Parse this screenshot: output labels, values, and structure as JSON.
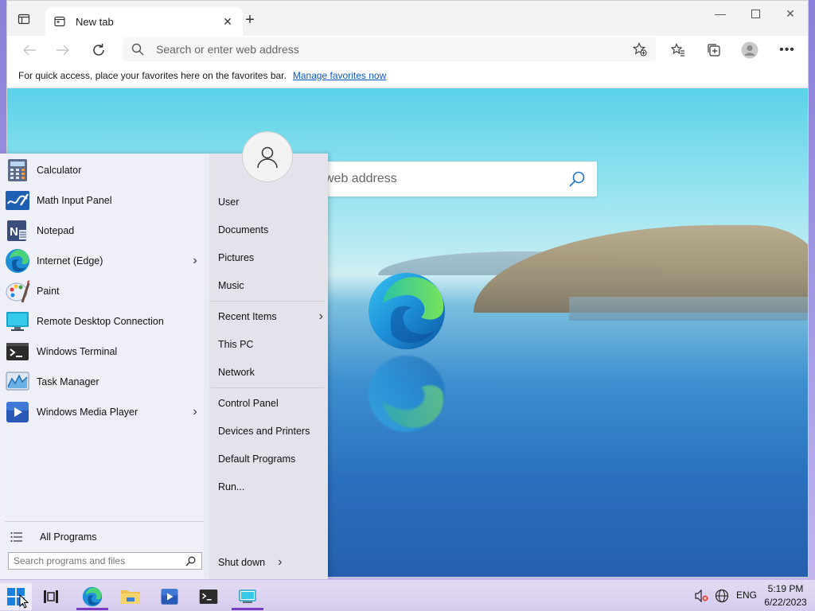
{
  "browser": {
    "tab_title": "New tab",
    "address_placeholder": "Search or enter web address",
    "favorites_message": "For quick access, place your favorites here on the favorites bar.",
    "favorites_link": "Manage favorites now",
    "page_search_placeholder": "web address"
  },
  "start_menu": {
    "apps": [
      {
        "label": "Calculator",
        "icon": "calculator-icon",
        "has_submenu": false
      },
      {
        "label": "Math Input Panel",
        "icon": "math-input-icon",
        "has_submenu": false
      },
      {
        "label": "Notepad",
        "icon": "notepad-icon",
        "has_submenu": false
      },
      {
        "label": "Internet (Edge)",
        "icon": "edge-icon",
        "has_submenu": true
      },
      {
        "label": "Paint",
        "icon": "paint-icon",
        "has_submenu": false
      },
      {
        "label": "Remote Desktop Connection",
        "icon": "remote-desktop-icon",
        "has_submenu": false
      },
      {
        "label": "Windows Terminal",
        "icon": "terminal-icon",
        "has_submenu": false
      },
      {
        "label": "Task Manager",
        "icon": "task-manager-icon",
        "has_submenu": false
      },
      {
        "label": "Windows Media Player",
        "icon": "media-player-icon",
        "has_submenu": true
      }
    ],
    "all_programs": "All Programs",
    "search_placeholder": "Search programs and files",
    "right_items": [
      {
        "label": "User",
        "has_submenu": false
      },
      {
        "label": "Documents",
        "has_submenu": false
      },
      {
        "label": "Pictures",
        "has_submenu": false
      },
      {
        "label": "Music",
        "has_submenu": false
      },
      {
        "label": "Recent Items",
        "has_submenu": true
      },
      {
        "label": "This PC",
        "has_submenu": false
      },
      {
        "label": "Network",
        "has_submenu": false
      },
      {
        "label": "Control Panel",
        "has_submenu": false
      },
      {
        "label": "Devices and Printers",
        "has_submenu": false
      },
      {
        "label": "Default Programs",
        "has_submenu": false
      },
      {
        "label": "Run...",
        "has_submenu": false
      }
    ],
    "shutdown": "Shut down"
  },
  "taskbar": {
    "language": "ENG",
    "time": "5:19 PM",
    "date": "6/22/2023"
  },
  "colors": {
    "accent": "#7a3ac8",
    "link": "#0a58ca"
  }
}
